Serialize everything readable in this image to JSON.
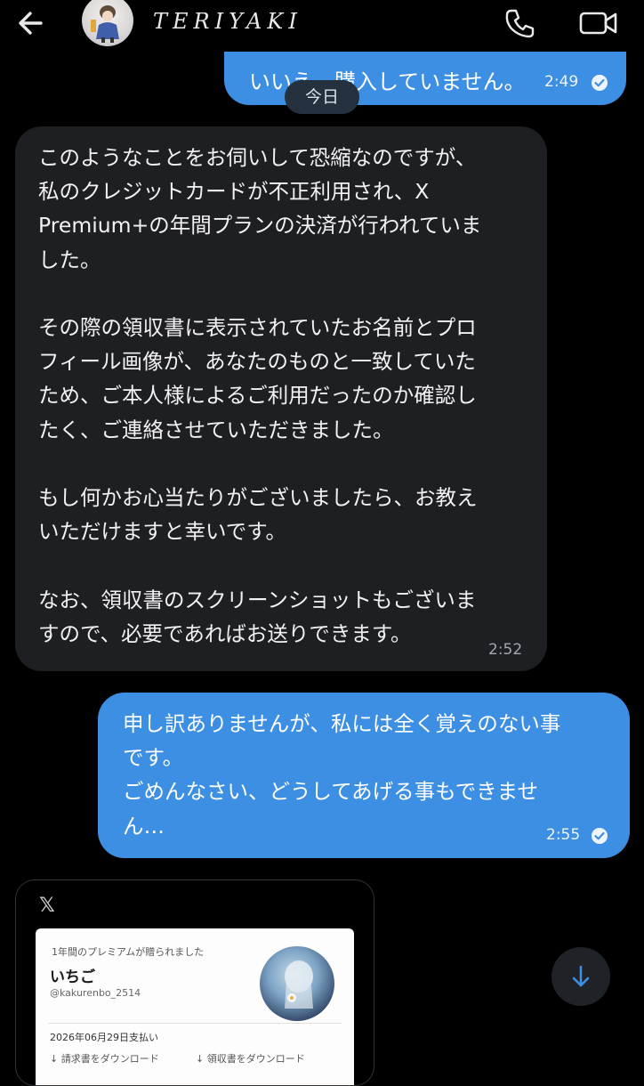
{
  "header": {
    "title": "TERIYAKI",
    "back_icon": "arrow-left-icon",
    "call_icon": "phone-icon",
    "video_icon": "video-camera-icon"
  },
  "messages": [
    {
      "direction": "outgoing",
      "text": "いいえ、購入していません。",
      "time": "2:49",
      "read": true
    },
    {
      "direction": "incoming",
      "text": "このようなことをお伺いして恐縮なのですが、\n私のクレジットカードが不正利用され、X\nPremium+の年間プランの決済が行われていま\nした。\n\nその際の領収書に表示されていたお名前とプロ\nフィール画像が、あなたのものと一致していた\nため、ご本人様によるご利用だったのか確認し\nたく、ご連絡させていただきました。\n\nもし何かお心当たりがございましたら、お教え\nいただけますと幸いです。\n\nなお、領収書のスクリーンショットもございま\nすので、必要であればお送りできます。",
      "time": "2:52"
    },
    {
      "direction": "outgoing",
      "text": "申し訳ありませんが、私には全く覚えのない事\nです。\nごめんなさい、どうしてあげる事もできませ\nん…",
      "time": "2:55",
      "read": true
    }
  ],
  "day_divider": "今日",
  "shared_card": {
    "source": "𝕏",
    "caption": "1年間のプレミアムが贈られました",
    "name": "いちご",
    "handle": "@kakurenbo_2514",
    "paid_date": "2026年06月29日支払い",
    "download_invoice": "↓  請求書をダウンロード",
    "download_receipt": "↓  領収書をダウンロード"
  },
  "colors": {
    "outgoing_bubble": "#3d8fe3",
    "incoming_bubble": "#1e1f22",
    "background": "#000000"
  }
}
